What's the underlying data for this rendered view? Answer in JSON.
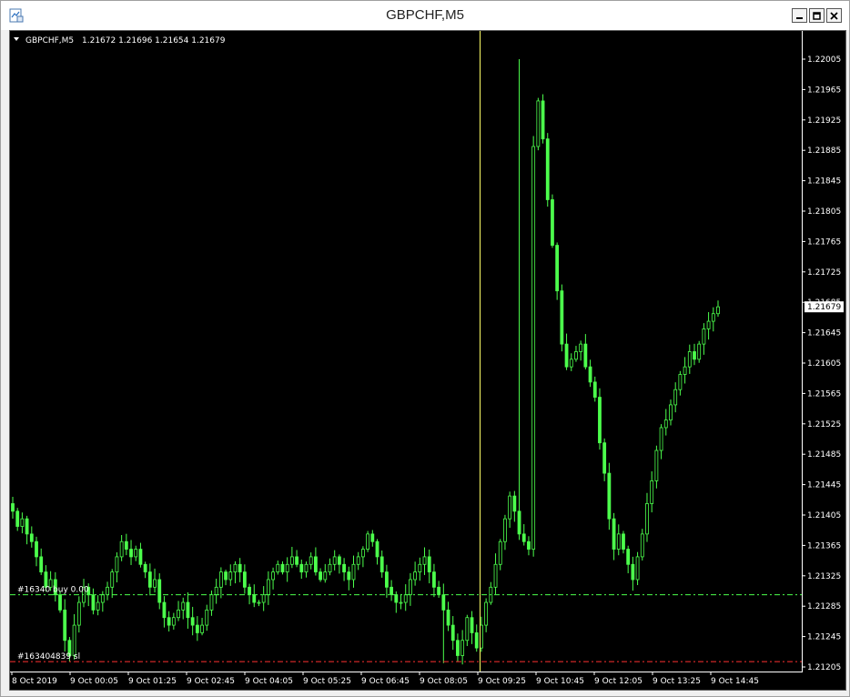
{
  "window": {
    "title": "GBPCHF,M5",
    "buttons": [
      "minimize",
      "maximize",
      "close"
    ]
  },
  "chart_info": {
    "dropdown_icon": "triangle-down-icon",
    "symbol": "GBPCHF,M5",
    "ohlc": "1.21672 1.21696 1.21654 1.21679"
  },
  "chart_data": {
    "type": "candlestick",
    "symbol": "GBPCHF",
    "timeframe": "M5",
    "price_ticks": [
      "1.22005",
      "1.21965",
      "1.21925",
      "1.21885",
      "1.21845",
      "1.21805",
      "1.21765",
      "1.21725",
      "1.21685",
      "1.21645",
      "1.21605",
      "1.21565",
      "1.21525",
      "1.21485",
      "1.21445",
      "1.21405",
      "1.21365",
      "1.21325",
      "1.21285",
      "1.21245",
      "1.21205"
    ],
    "ylim": [
      1.21205,
      1.22005
    ],
    "time_ticks": [
      "8 Oct 2019",
      "9 Oct 00:05",
      "9 Oct 01:25",
      "9 Oct 02:45",
      "9 Oct 04:05",
      "9 Oct 05:25",
      "9 Oct 06:45",
      "9 Oct 08:05",
      "9 Oct 09:25",
      "9 Oct 10:45",
      "9 Oct 12:05",
      "9 Oct 13:25",
      "9 Oct 14:45"
    ],
    "current_price": "1.21679",
    "candle_color": "#4cff4c",
    "background": "#000000",
    "grid": false,
    "vertical_line": {
      "label_time": "9 Oct 09:25",
      "color": "#ffff66"
    },
    "levels": [
      {
        "label": "#16340 buy 0.00",
        "label_full": "#163404839 buy 0.00",
        "price": 1.213,
        "color": "#4cff4c",
        "style": "dash-dot"
      },
      {
        "label": "#163404839 sl",
        "price": 1.21212,
        "color": "#ff3030",
        "style": "dash-dot"
      }
    ],
    "series_close": [
      1.2141,
      1.2139,
      1.214,
      1.2138,
      1.2137,
      1.2135,
      1.2133,
      1.2131,
      1.2132,
      1.213,
      1.2128,
      1.2124,
      1.2122,
      1.2126,
      1.2129,
      1.2131,
      1.213,
      1.2128,
      1.2129,
      1.213,
      1.2131,
      1.2133,
      1.2135,
      1.2137,
      1.2136,
      1.2135,
      1.2136,
      1.2134,
      1.2133,
      1.2131,
      1.2132,
      1.2129,
      1.2127,
      1.2126,
      1.2127,
      1.2128,
      1.2129,
      1.2127,
      1.2126,
      1.2125,
      1.2126,
      1.2128,
      1.213,
      1.2131,
      1.2133,
      1.2132,
      1.2133,
      1.2134,
      1.2133,
      1.2131,
      1.213,
      1.2129,
      1.2129,
      1.213,
      1.2132,
      1.2133,
      1.2134,
      1.2133,
      1.2134,
      1.2135,
      1.2134,
      1.2133,
      1.2134,
      1.2135,
      1.2133,
      1.2132,
      1.2133,
      1.2134,
      1.2135,
      1.2134,
      1.2133,
      1.2132,
      1.2134,
      1.2135,
      1.2136,
      1.2138,
      1.2137,
      1.2135,
      1.2133,
      1.2131,
      1.213,
      1.2129,
      1.2129,
      1.213,
      1.2132,
      1.2133,
      1.2134,
      1.2135,
      1.2133,
      1.2131,
      1.213,
      1.2128,
      1.2126,
      1.2124,
      1.2122,
      1.2124,
      1.2127,
      1.2125,
      1.2123,
      1.2126,
      1.2129,
      1.2131,
      1.2134,
      1.2137,
      1.214,
      1.2143,
      1.2141,
      1.2138,
      1.2137,
      1.2136,
      1.2189,
      1.2195,
      1.219,
      1.2182,
      1.2176,
      1.217,
      1.2163,
      1.216,
      1.2161,
      1.2162,
      1.2163,
      1.216,
      1.2158,
      1.2156,
      1.215,
      1.2146,
      1.214,
      1.2136,
      1.2138,
      1.2136,
      1.2134,
      1.2132,
      1.2135,
      1.2138,
      1.2142,
      1.2145,
      1.2149,
      1.2152,
      1.2153,
      1.2155,
      1.2157,
      1.2159,
      1.216,
      1.2162,
      1.2161,
      1.2163,
      1.2165,
      1.2166,
      1.2167,
      1.21679
    ]
  }
}
